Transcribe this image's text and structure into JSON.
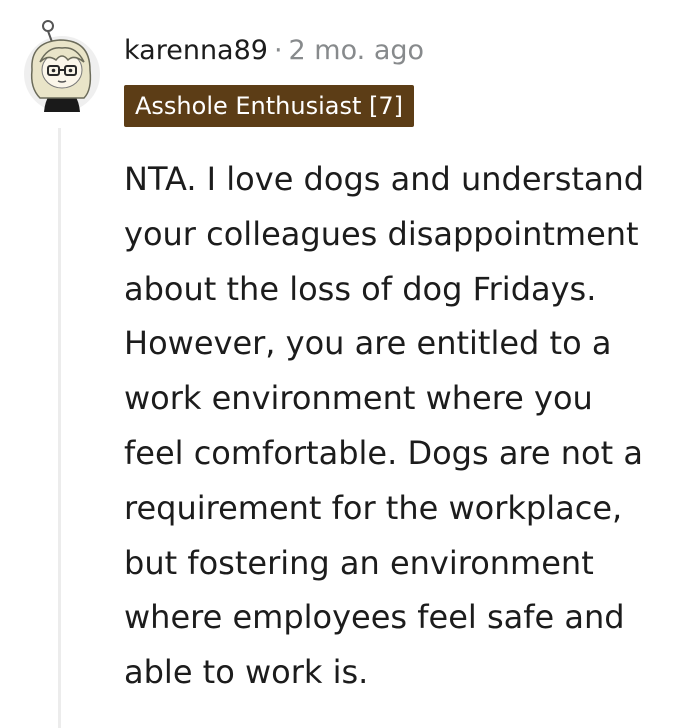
{
  "comment": {
    "author": "karenna89",
    "separator": "·",
    "age": "2 mo. ago",
    "flair": "Asshole Enthusiast [7]",
    "flair_color": "#5c3d16",
    "avatar_icon": "avatar-icon",
    "body_lines": [
      "NTA. I love dogs and understand",
      "your colleagues disappointment",
      "about the loss of dog Fridays.",
      "However, you are entitled to a",
      "work environment where you",
      "feel comfortable. Dogs are not a",
      "requirement for the workplace,",
      "but fostering an environment",
      "where employees feel safe and",
      "able to work is."
    ]
  }
}
